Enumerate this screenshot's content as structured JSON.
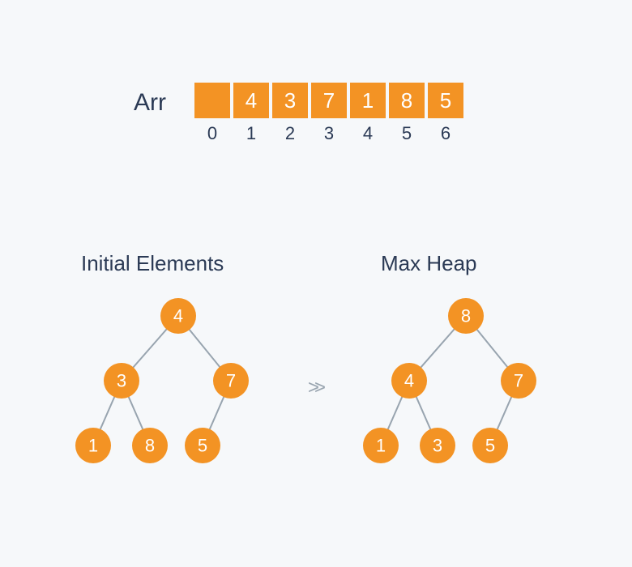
{
  "array": {
    "label": "Arr",
    "values": [
      "",
      "4",
      "3",
      "7",
      "1",
      "8",
      "5"
    ],
    "indices": [
      "0",
      "1",
      "2",
      "3",
      "4",
      "5",
      "6"
    ]
  },
  "trees": {
    "left_title": "Initial Elements",
    "right_title": "Max Heap",
    "arrow": ">>",
    "left": {
      "n1": "4",
      "n2": "3",
      "n3": "7",
      "n4": "1",
      "n5": "8",
      "n6": "5"
    },
    "right": {
      "n1": "8",
      "n2": "4",
      "n3": "7",
      "n4": "1",
      "n5": "3",
      "n6": "5"
    }
  },
  "chart_data": {
    "type": "diagram",
    "description": "Array representation and binary heap trees",
    "array_label": "Arr",
    "array_indices": [
      0,
      1,
      2,
      3,
      4,
      5,
      6
    ],
    "array_values": [
      null,
      4,
      3,
      7,
      1,
      8,
      5
    ],
    "initial_tree": {
      "title": "Initial Elements",
      "nodes": [
        {
          "id": 1,
          "value": 4,
          "parent": null
        },
        {
          "id": 2,
          "value": 3,
          "parent": 1
        },
        {
          "id": 3,
          "value": 7,
          "parent": 1
        },
        {
          "id": 4,
          "value": 1,
          "parent": 2
        },
        {
          "id": 5,
          "value": 8,
          "parent": 2
        },
        {
          "id": 6,
          "value": 5,
          "parent": 3
        }
      ]
    },
    "max_heap_tree": {
      "title": "Max Heap",
      "nodes": [
        {
          "id": 1,
          "value": 8,
          "parent": null
        },
        {
          "id": 2,
          "value": 4,
          "parent": 1
        },
        {
          "id": 3,
          "value": 7,
          "parent": 1
        },
        {
          "id": 4,
          "value": 1,
          "parent": 2
        },
        {
          "id": 5,
          "value": 3,
          "parent": 2
        },
        {
          "id": 6,
          "value": 5,
          "parent": 3
        }
      ]
    }
  }
}
